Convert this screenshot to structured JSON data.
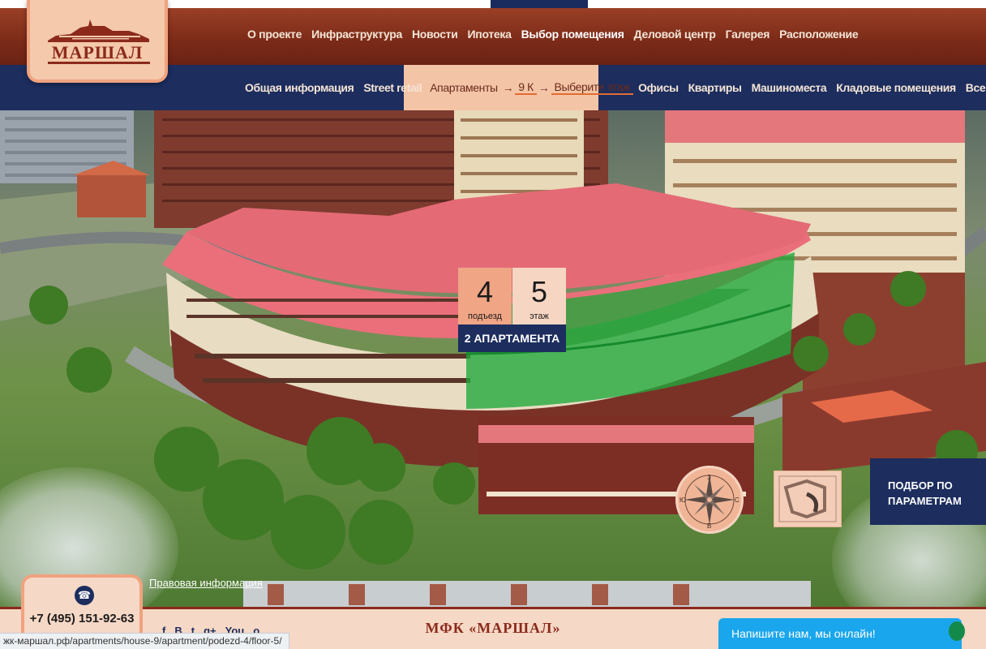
{
  "logo": {
    "text": "МАРШАЛ"
  },
  "nav_main": {
    "items": [
      {
        "label": "О проекте"
      },
      {
        "label": "Инфраструктура"
      },
      {
        "label": "Новости"
      },
      {
        "label": "Ипотека"
      },
      {
        "label": "Выбор помещения",
        "active": true
      },
      {
        "label": "Деловой центр"
      },
      {
        "label": "Галерея"
      },
      {
        "label": "Расположение"
      }
    ]
  },
  "nav_sub": {
    "before": [
      {
        "label": "Общая информация"
      },
      {
        "label": "Street retail"
      }
    ],
    "trail": [
      {
        "label": "Апартаменты"
      },
      {
        "label": "→"
      },
      {
        "label": "9 К"
      },
      {
        "label": "→"
      },
      {
        "label": "Выберите этаж"
      }
    ],
    "after": [
      {
        "label": "Офисы"
      },
      {
        "label": "Квартиры"
      },
      {
        "label": "Машиноместа"
      },
      {
        "label": "Кладовые помещения"
      },
      {
        "label": "Все типы"
      }
    ]
  },
  "floor_badge": {
    "entrance_number": "4",
    "entrance_label": "подъезд",
    "floor_number": "5",
    "floor_label": "этаж",
    "apartments": "2 АПАРТАМЕНТА"
  },
  "compass": {
    "n": "З",
    "s": "В",
    "w": "Ю",
    "e": "С"
  },
  "param_button": {
    "line1": "ПОДБОР ПО",
    "line2": "ПАРАМЕТРАМ"
  },
  "legal_link": "Правовая информация",
  "footer": {
    "title": "МФК «МАРШАЛ»",
    "phone": "+7 (495) 151-92-63",
    "socials": [
      "f",
      "В",
      "t",
      "g+",
      "You",
      "о"
    ]
  },
  "chat": {
    "label": "Напишите нам, мы онлайн!"
  },
  "status_url": "жк-маршал.рф/apartments/house-9/apartment/podezd-4/floor-5/",
  "colors": {
    "brand_brown": "#7b2a18",
    "navy": "#1c2d5e",
    "peach": "#f4c4a6",
    "highlight_green": "#1fa83a",
    "chat_blue": "#1aa6ec"
  }
}
